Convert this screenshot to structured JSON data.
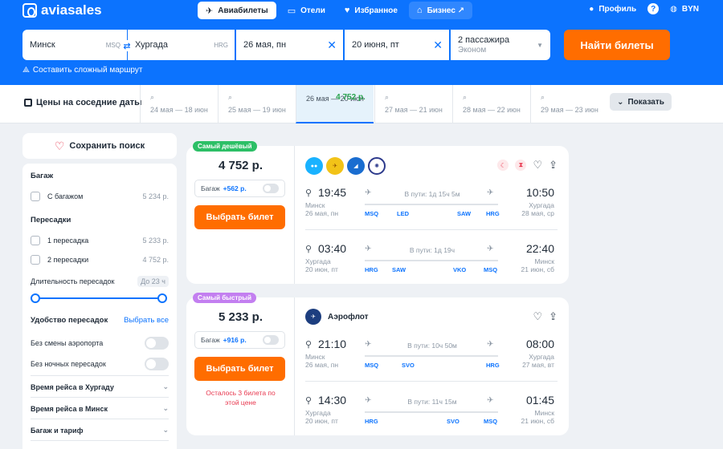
{
  "header": {
    "logo": "aviasales",
    "tabs": [
      {
        "label": "Авиабилеты",
        "icon": "plane-icon"
      },
      {
        "label": "Отели",
        "icon": "bed-icon"
      },
      {
        "label": "Избранное",
        "icon": "heart-icon"
      },
      {
        "label": "Бизнес ↗",
        "icon": "seat-icon"
      }
    ],
    "profile": "Профиль",
    "help": "?",
    "currency": "BYN"
  },
  "search": {
    "from": "Минск",
    "from_code": "MSQ",
    "to": "Хургада",
    "to_code": "HRG",
    "depart": "26 мая, пн",
    "return": "20 июня, пт",
    "passengers": "2 пассажира",
    "class": "Эконом",
    "find_label": "Найти билеты",
    "complex_route": "Составить сложный маршрут"
  },
  "dates": {
    "title": "Цены на соседние даты",
    "cells": [
      {
        "range": "24 мая — 18 июн",
        "price": ""
      },
      {
        "range": "25 мая — 19 июн",
        "price": ""
      },
      {
        "range": "26 мая — 20 июн",
        "price": "4 752 р."
      },
      {
        "range": "27 мая — 21 июн",
        "price": ""
      },
      {
        "range": "28 мая — 22 июн",
        "price": ""
      },
      {
        "range": "29 мая — 23 июн",
        "price": ""
      }
    ],
    "show_label": "Показать"
  },
  "sidebar": {
    "save_search": "Сохранить поиск",
    "baggage_title": "Багаж",
    "with_baggage": "С багажом",
    "with_baggage_price": "5 234 р.",
    "transfers_title": "Пересадки",
    "one_transfer": "1 пересадка",
    "one_transfer_price": "5 233 р.",
    "two_transfers": "2 пересадки",
    "two_transfers_price": "4 752 р.",
    "duration_title": "Длительность пересадок",
    "duration_value": "До 23 ч",
    "comfort_title": "Удобство пересадок",
    "select_all": "Выбрать все",
    "no_airport_change": "Без смены аэропорта",
    "no_night": "Без ночных пересадок",
    "time_to": "Время рейса в Хургаду",
    "time_back": "Время рейса в Минск",
    "baggage_tariff": "Багаж и тариф"
  },
  "results": [
    {
      "tag": "Самый дешёвый",
      "price": "4 752 р.",
      "baggage_label": "Багаж",
      "baggage_extra": "+562 р.",
      "buy_label": "Выбрать билет",
      "airlines": [
        "",
        "",
        "",
        ""
      ],
      "segments": [
        {
          "dep_time": "19:45",
          "dep_city": "Минск",
          "dep_date": "26 мая, пн",
          "duration": "В пути: 1д 15ч 5м",
          "arr_time": "10:50",
          "arr_city": "Хургада",
          "arr_date": "28 мая, ср",
          "codes": [
            "MSQ",
            "LED",
            "SAW",
            "HRG"
          ]
        },
        {
          "dep_time": "03:40",
          "dep_city": "Хургада",
          "dep_date": "20 июн, пт",
          "duration": "В пути: 1д 19ч",
          "arr_time": "22:40",
          "arr_city": "Минск",
          "arr_date": "21 июн, сб",
          "codes": [
            "HRG",
            "SAW",
            "VKO",
            "MSQ"
          ]
        }
      ]
    },
    {
      "tag": "Самый быстрый",
      "price": "5 233 р.",
      "baggage_label": "Багаж",
      "baggage_extra": "+916 р.",
      "buy_label": "Выбрать билет",
      "warning": "Осталось 3 билета по этой цене",
      "airline_name": "Аэрофлот",
      "segments": [
        {
          "dep_time": "21:10",
          "dep_city": "Минск",
          "dep_date": "26 мая, пн",
          "duration": "В пути: 10ч 50м",
          "arr_time": "08:00",
          "arr_city": "Хургада",
          "arr_date": "27 мая, вт",
          "codes": [
            "MSQ",
            "SVO",
            "HRG"
          ]
        },
        {
          "dep_time": "14:30",
          "dep_city": "Хургада",
          "dep_date": "20 июн, пт",
          "duration": "В пути: 11ч 15м",
          "arr_time": "01:45",
          "arr_city": "Минск",
          "arr_date": "21 июн, сб",
          "codes": [
            "HRG",
            "SVO",
            "MSQ"
          ]
        }
      ]
    }
  ],
  "colors": {
    "brand": "#0c73fe",
    "accent": "#ff6d00",
    "success": "#2cbf66",
    "fast": "#c37ff0"
  }
}
